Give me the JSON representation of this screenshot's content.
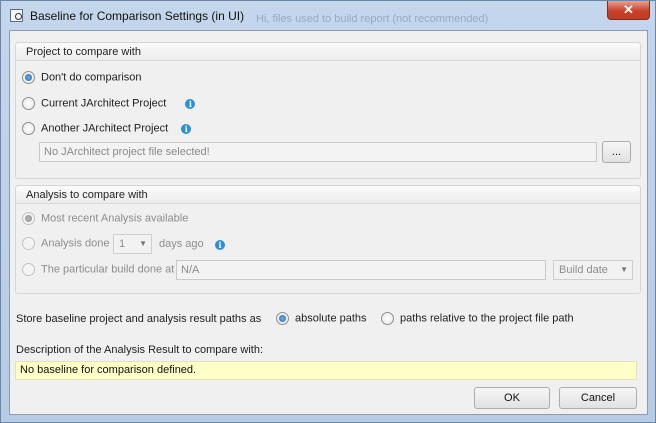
{
  "window": {
    "title": "Baseline for Comparison Settings (in UI)",
    "ghost_text": "Hi, files used to build report (not recommended)",
    "close_label": "✕"
  },
  "project_group": {
    "header": "Project to compare with",
    "options": [
      {
        "label": "Don't do comparison",
        "checked": true
      },
      {
        "label": "Current JArchitect Project",
        "checked": false
      },
      {
        "label": "Another JArchitect Project",
        "checked": false
      }
    ],
    "file_placeholder": "No JArchitect project file selected!",
    "browse_label": "..."
  },
  "analysis_group": {
    "header": "Analysis to compare with",
    "most_recent_label": "Most recent Analysis available",
    "analysis_done_label": "Analysis done",
    "days_value": "1",
    "days_ago_label": "days ago",
    "particular_build_label": "The particular build done at",
    "build_value": "N/A",
    "build_date_label": "Build date"
  },
  "paths": {
    "label": "Store baseline project and analysis result paths as",
    "absolute_label": "absolute paths",
    "relative_label": "paths relative to the project file path",
    "selected": "absolute"
  },
  "description": {
    "label": "Description of the Analysis Result to compare with:",
    "value": "No baseline for comparison defined."
  },
  "buttons": {
    "ok": "OK",
    "cancel": "Cancel"
  },
  "icons": {
    "info": "info-icon",
    "app": "app-icon"
  },
  "colors": {
    "description_bg": "#ffffc8",
    "radio_accent": "#1f5fa8",
    "info_icon": "#2e8fd8"
  }
}
